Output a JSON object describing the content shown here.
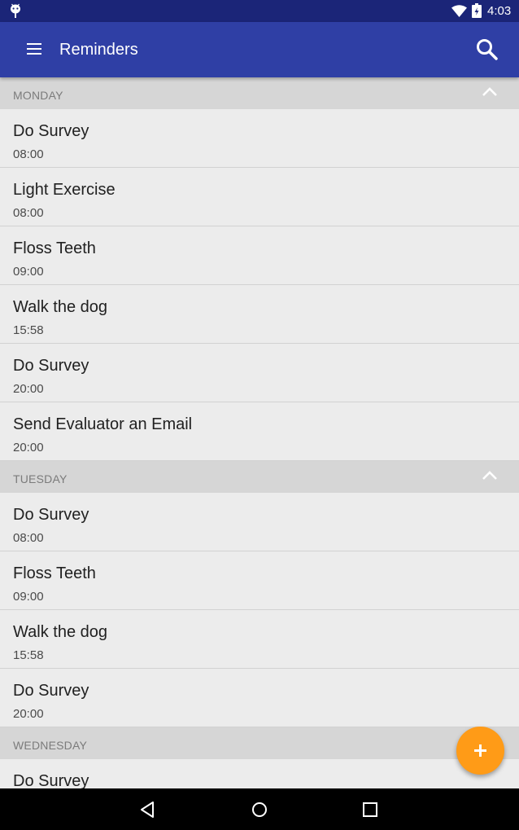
{
  "status_bar": {
    "time": "4:03",
    "icons": [
      "android-icon",
      "wifi-icon",
      "battery-icon"
    ]
  },
  "app_bar": {
    "title": "Reminders",
    "icons": [
      "menu-icon",
      "search-icon"
    ]
  },
  "colors": {
    "status_bar": "#1b2578",
    "app_bar": "#2f3fa5",
    "content_bg": "#ececec",
    "section_header_bg": "#d6d6d6",
    "fab": "#ff9b17",
    "nav_bar": "#000000"
  },
  "sections": [
    {
      "day": "MONDAY",
      "expanded": true,
      "items": [
        {
          "title": "Do Survey",
          "time": "08:00"
        },
        {
          "title": "Light Exercise",
          "time": "08:00"
        },
        {
          "title": "Floss Teeth",
          "time": "09:00"
        },
        {
          "title": "Walk the dog",
          "time": "15:58"
        },
        {
          "title": "Do Survey",
          "time": "20:00"
        },
        {
          "title": "Send Evaluator an Email",
          "time": "20:00"
        }
      ]
    },
    {
      "day": "TUESDAY",
      "expanded": true,
      "items": [
        {
          "title": "Do Survey",
          "time": "08:00"
        },
        {
          "title": "Floss Teeth",
          "time": "09:00"
        },
        {
          "title": "Walk the dog",
          "time": "15:58"
        },
        {
          "title": "Do Survey",
          "time": "20:00"
        }
      ]
    },
    {
      "day": "WEDNESDAY",
      "expanded": true,
      "items": [
        {
          "title": "Do Survey",
          "time": ""
        }
      ]
    }
  ],
  "fab": {
    "icon": "plus-icon"
  },
  "nav_bar": {
    "icons": [
      "back-icon",
      "home-icon",
      "recents-icon"
    ]
  }
}
